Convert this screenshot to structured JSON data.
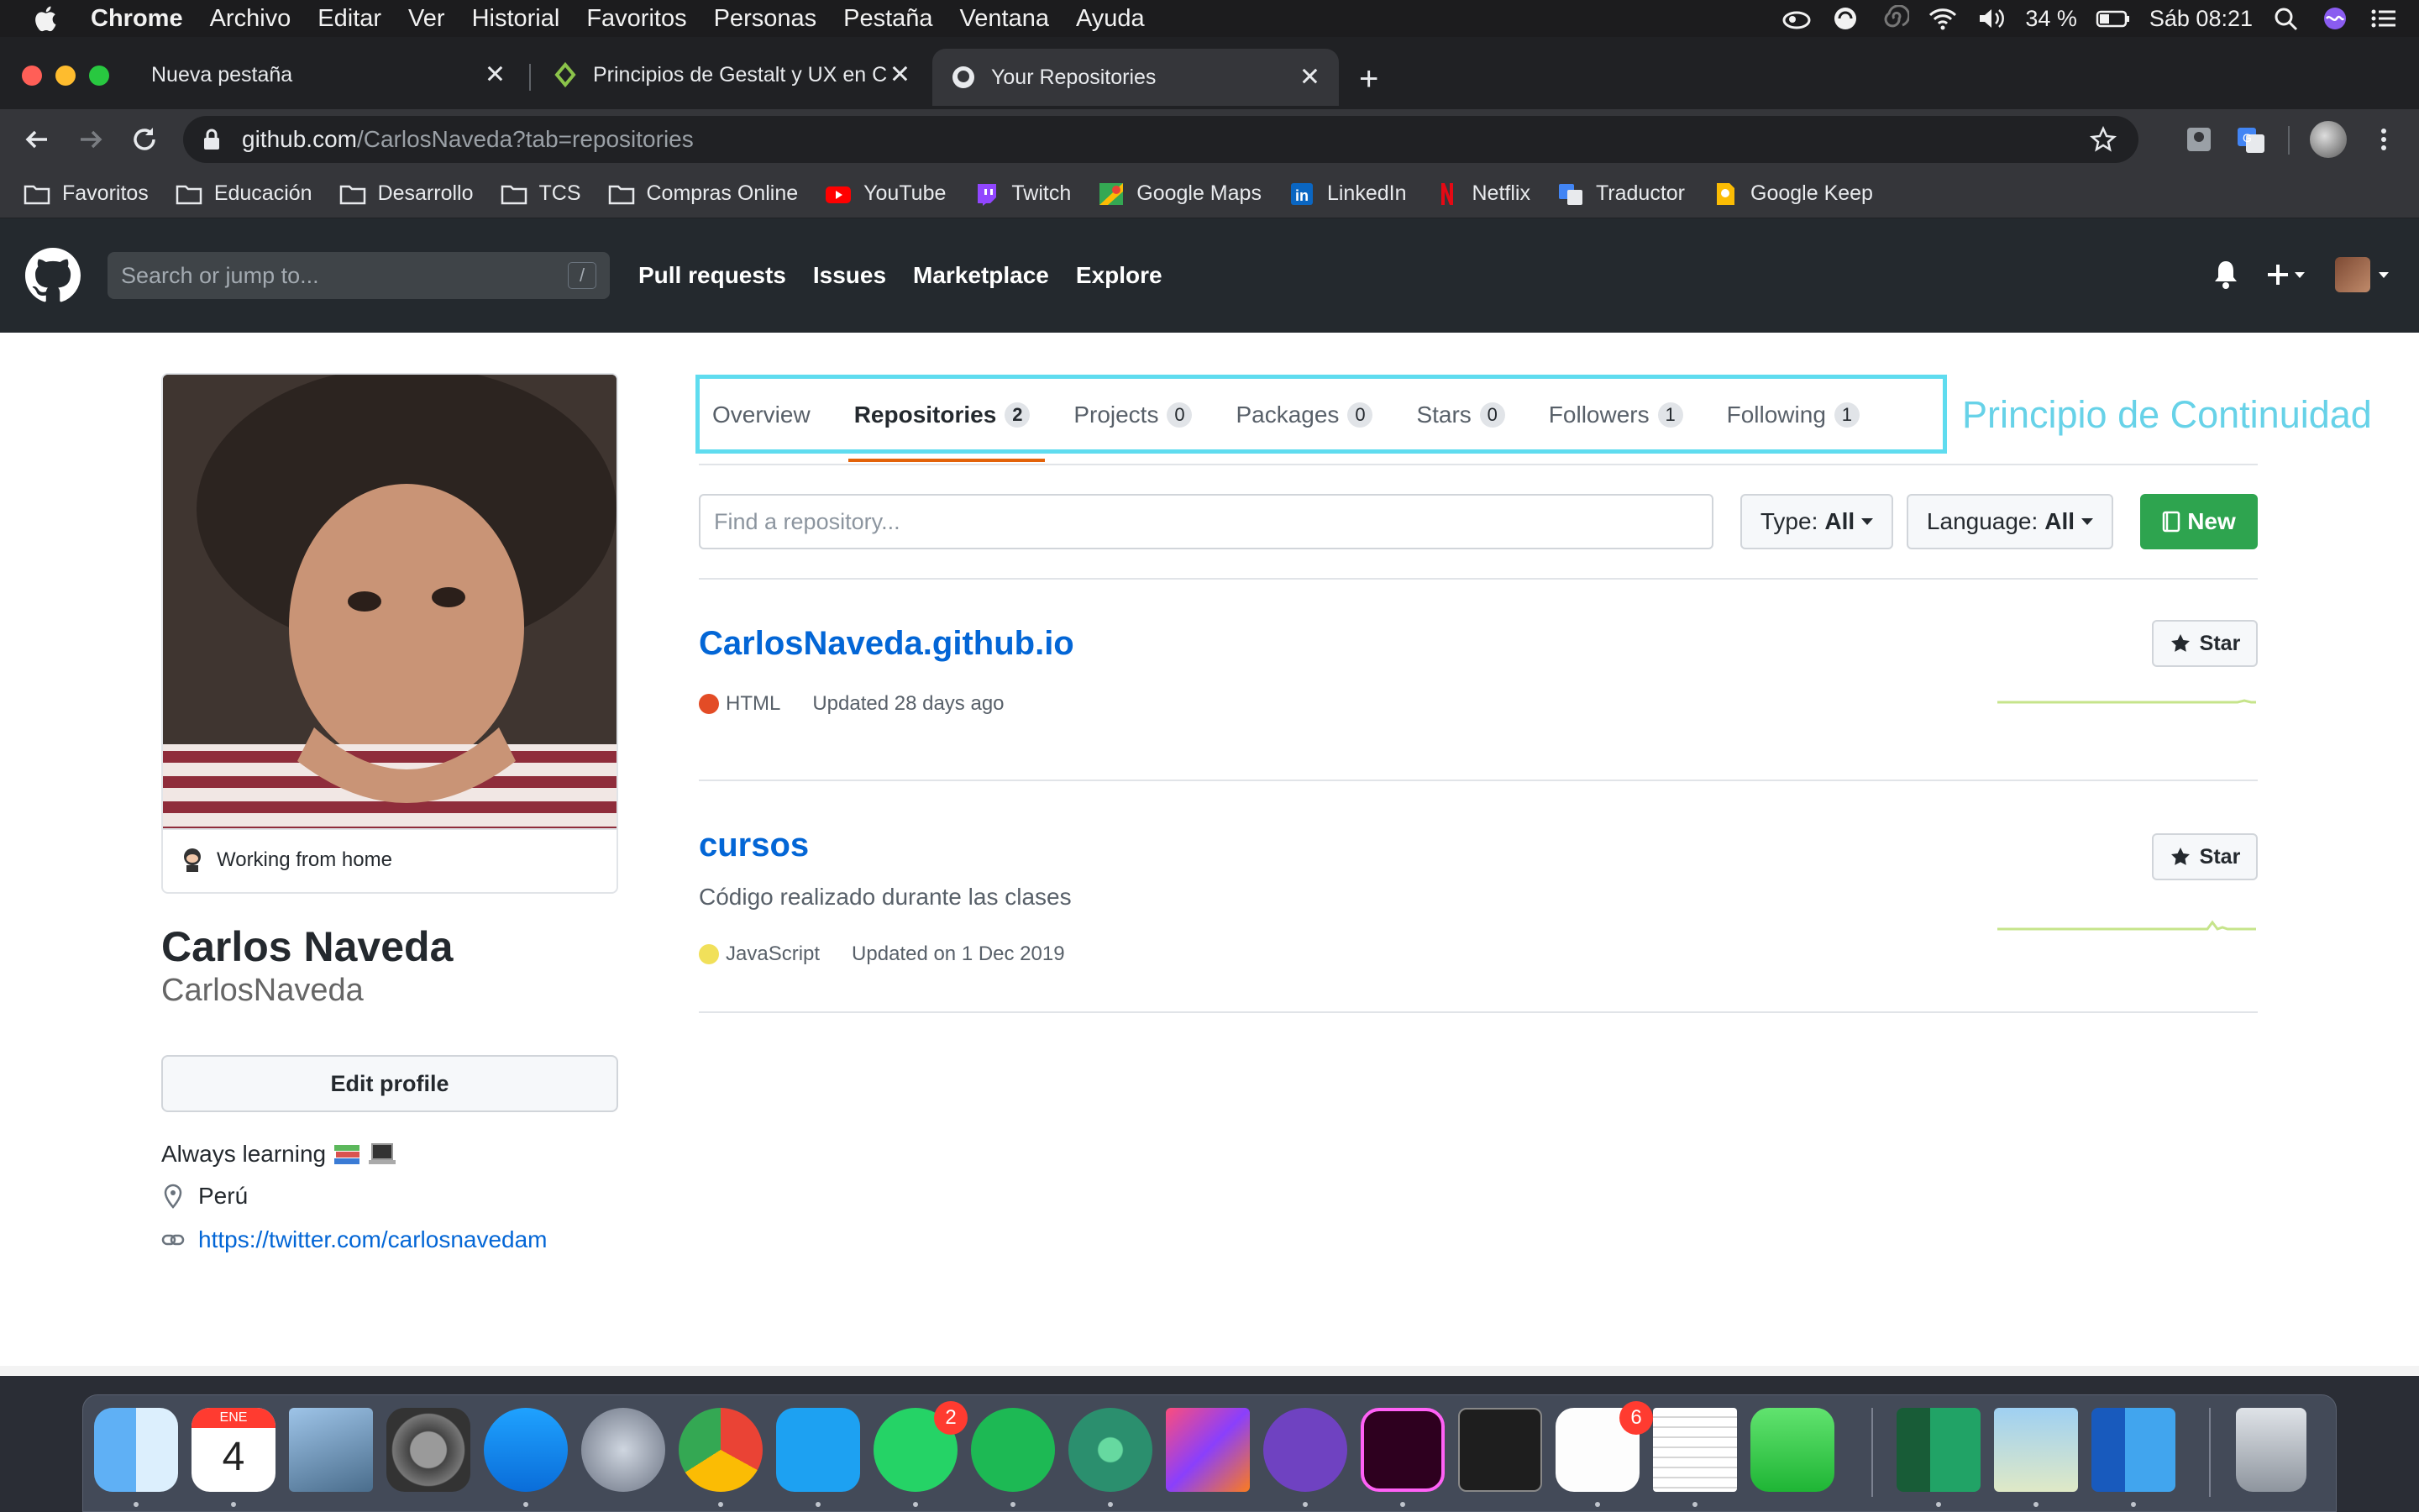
{
  "menubar": {
    "app": "Chrome",
    "menus": [
      "Archivo",
      "Editar",
      "Ver",
      "Historial",
      "Favoritos",
      "Personas",
      "Pestaña",
      "Ventana",
      "Ayuda"
    ],
    "battery": "34 %",
    "clock": "Sáb 08:21"
  },
  "browser": {
    "tabs": [
      {
        "title": "Nueva pestaña"
      },
      {
        "title": "Principios de Gestalt y UX en Cu"
      },
      {
        "title": "Your Repositories"
      }
    ],
    "url_host": "github.com",
    "url_path": "/CarlosNaveda?tab=repositories",
    "bookmarks": [
      "Favoritos",
      "Educación",
      "Desarrollo",
      "TCS",
      "Compras Online",
      "YouTube",
      "Twitch",
      "Google Maps",
      "LinkedIn",
      "Netflix",
      "Traductor",
      "Google Keep"
    ]
  },
  "github": {
    "search_placeholder": "Search or jump to...",
    "search_shortcut": "/",
    "nav": [
      "Pull requests",
      "Issues",
      "Marketplace",
      "Explore"
    ]
  },
  "profile": {
    "status": "Working from home",
    "full_name": "Carlos Naveda",
    "login": "CarlosNaveda",
    "edit_label": "Edit profile",
    "bio": "Always learning",
    "location": "Perú",
    "website": "https://twitter.com/carlosnavedam"
  },
  "tabs": [
    {
      "label": "Overview",
      "count": ""
    },
    {
      "label": "Repositories",
      "count": "2"
    },
    {
      "label": "Projects",
      "count": "0"
    },
    {
      "label": "Packages",
      "count": "0"
    },
    {
      "label": "Stars",
      "count": "0"
    },
    {
      "label": "Followers",
      "count": "1"
    },
    {
      "label": "Following",
      "count": "1"
    }
  ],
  "annotation": "Principio de Continuidad",
  "filters": {
    "find_placeholder": "Find a repository...",
    "type_label": "Type:",
    "type_value": "All",
    "language_label": "Language:",
    "language_value": "All",
    "new_label": "New"
  },
  "repos": [
    {
      "name": "CarlosNaveda.github.io",
      "description": "",
      "language": "HTML",
      "language_color": "#e34c26",
      "updated": "Updated 28 days ago",
      "star_label": "Star"
    },
    {
      "name": "cursos",
      "description": "Código realizado durante las clases",
      "language": "JavaScript",
      "language_color": "#f1e05a",
      "updated": "Updated on 1 Dec 2019",
      "star_label": "Star"
    }
  ],
  "dock": {
    "calendar_month": "ENE",
    "calendar_day": "4",
    "whatsapp_badge": "2",
    "reminders_badge": "6"
  },
  "colors": {
    "accent_link": "#0366d6",
    "tab_underline": "#e36209",
    "annotation": "#5fdcef",
    "new_button": "#2ea44f"
  }
}
